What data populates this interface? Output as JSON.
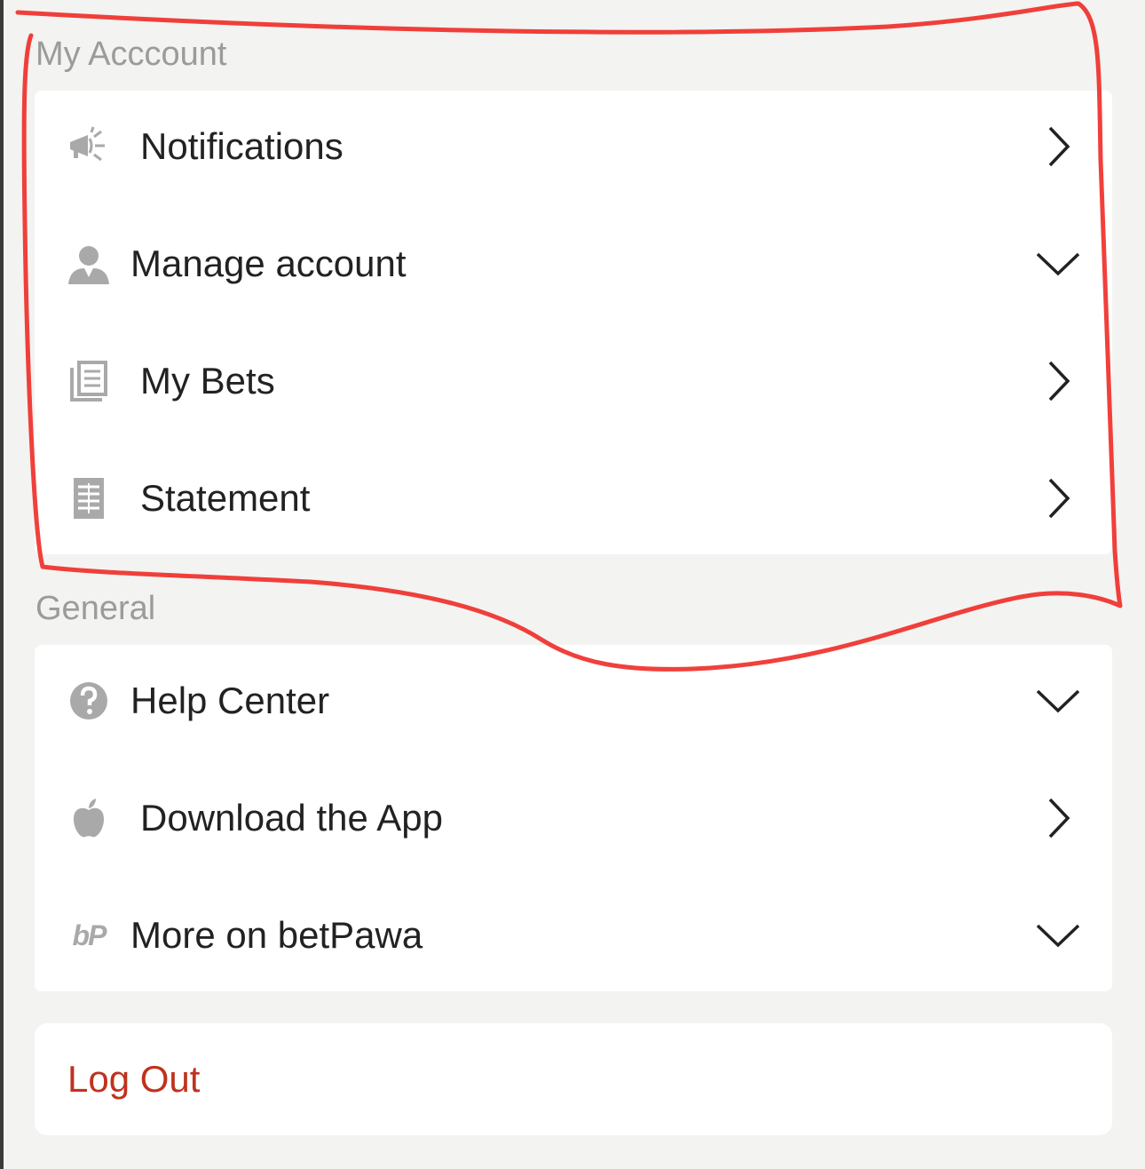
{
  "sections": {
    "my_account": {
      "title": "My Acccount",
      "items": [
        {
          "label": "Notifications",
          "icon": "megaphone-icon",
          "indicator": "chevron-right"
        },
        {
          "label": "Manage account",
          "icon": "user-icon",
          "indicator": "chevron-down"
        },
        {
          "label": "My Bets",
          "icon": "bet-slips-icon",
          "indicator": "chevron-right"
        },
        {
          "label": "Statement",
          "icon": "statement-icon",
          "indicator": "chevron-right"
        }
      ]
    },
    "general": {
      "title": "General",
      "items": [
        {
          "label": "Help Center",
          "icon": "help-icon",
          "indicator": "chevron-down"
        },
        {
          "label": "Download the App",
          "icon": "apple-icon",
          "indicator": "chevron-right"
        },
        {
          "label": "More on betPawa",
          "icon": "betpawa-logo-icon",
          "indicator": "chevron-down",
          "logo_text": "bP"
        }
      ]
    }
  },
  "logout": {
    "label": "Log Out"
  },
  "colors": {
    "background": "#f3f3f1",
    "card": "#ffffff",
    "section_header": "#9b9b9b",
    "item_text": "#222222",
    "icon": "#a9a9a9",
    "logout_text": "#c0321e",
    "annotation_stroke": "#f0302a"
  }
}
